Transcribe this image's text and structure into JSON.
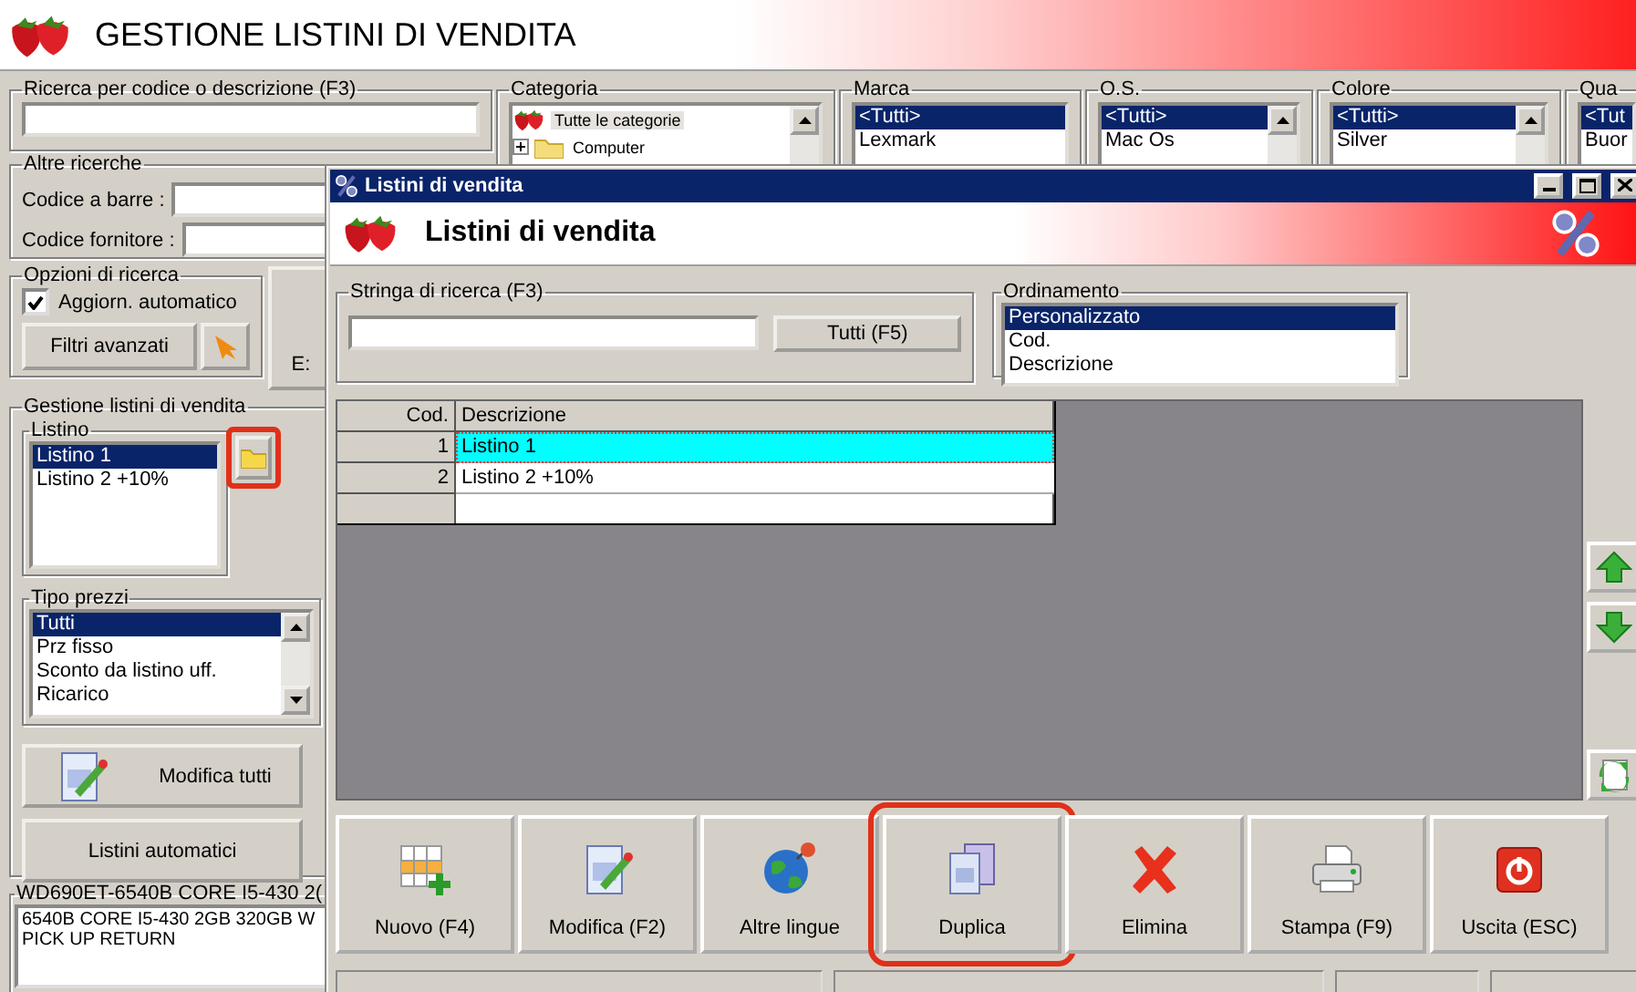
{
  "main_window": {
    "title": "GESTIONE LISTINI DI VENDITA",
    "search": {
      "label": "Ricerca per codice o descrizione (F3)"
    },
    "filters": [
      {
        "label": "Categoria",
        "kind": "tree",
        "items": [
          {
            "label": "Tutte le categorie",
            "selected": true
          },
          {
            "label": "Computer",
            "selected": false
          }
        ]
      },
      {
        "label": "Marca",
        "kind": "list",
        "items": [
          {
            "label": "<Tutti>",
            "selected": true
          },
          {
            "label": "Lexmark",
            "selected": false
          }
        ]
      },
      {
        "label": "O.S.",
        "kind": "list",
        "items": [
          {
            "label": "<Tutti>",
            "selected": true
          },
          {
            "label": "Mac Os",
            "selected": false
          }
        ]
      },
      {
        "label": "Colore",
        "kind": "list",
        "items": [
          {
            "label": "<Tutti>",
            "selected": true
          },
          {
            "label": "Silver",
            "selected": false
          }
        ]
      },
      {
        "label": "Qua",
        "kind": "list",
        "items": [
          {
            "label": "<Tut",
            "selected": true
          },
          {
            "label": "Buor",
            "selected": false
          }
        ]
      }
    ],
    "other_searches": {
      "label": "Altre ricerche",
      "fields": [
        {
          "label": "Codice a barre :"
        },
        {
          "label": "Codice fornitore :"
        }
      ]
    },
    "search_options": {
      "label": "Opzioni di ricerca",
      "auto_update": {
        "label": "Aggiorn. automatico",
        "checked": true
      },
      "advanced_button": "Filtri avanzati"
    },
    "side_button": "E:",
    "price_lists": {
      "label": "Gestione listini di vendita",
      "list_label": "Listino",
      "folder_button": {
        "highlighted": true
      },
      "items": [
        {
          "label": "Listino 1",
          "selected": true
        },
        {
          "label": "Listino 2 +10%",
          "selected": false
        }
      ],
      "price_type": {
        "label": "Tipo prezzi",
        "items": [
          {
            "label": "Tutti",
            "selected": true
          },
          {
            "label": "Prz fisso",
            "selected": false
          },
          {
            "label": "Sconto da listino uff.",
            "selected": false
          },
          {
            "label": "Ricarico",
            "selected": false
          }
        ]
      },
      "buttons": [
        {
          "label": "Modifica tutti",
          "kind": "edit"
        },
        {
          "label": "Listini automatici",
          "kind": "plain"
        }
      ]
    },
    "product": {
      "title": "WD690ET-6540B CORE I5-430 2(",
      "lines": [
        "6540B CORE I5-430 2GB 320GB W",
        "PICK UP RETURN"
      ]
    }
  },
  "dialog": {
    "title": "Listini di vendita",
    "header": "Listini di vendita",
    "search": {
      "label": "Stringa di ricerca (F3)",
      "button": "Tutti (F5)"
    },
    "sort": {
      "label": "Ordinamento",
      "items": [
        {
          "label": "Personalizzato",
          "selected": true
        },
        {
          "label": "Cod.",
          "selected": false
        },
        {
          "label": "Descrizione",
          "selected": false
        }
      ]
    },
    "table": {
      "columns": [
        "Cod.",
        "Descrizione"
      ],
      "rows": [
        {
          "cells": [
            "1",
            "Listino 1"
          ],
          "selected": true
        },
        {
          "cells": [
            "2",
            "Listino 2 +10%"
          ],
          "selected": false
        }
      ]
    },
    "toolbar": [
      {
        "label": "Nuovo (F4)",
        "kind": "new",
        "highlighted": false
      },
      {
        "label": "Modifica (F2)",
        "kind": "edit",
        "highlighted": false
      },
      {
        "label": "Altre lingue",
        "kind": "globe",
        "highlighted": false
      },
      {
        "label": "Duplica",
        "kind": "duplicate",
        "highlighted": true
      },
      {
        "label": "Elimina",
        "kind": "delete",
        "highlighted": false
      },
      {
        "label": "Stampa (F9)",
        "kind": "print",
        "highlighted": false
      },
      {
        "label": "Uscita (ESC)",
        "kind": "exit",
        "highlighted": false
      }
    ]
  }
}
